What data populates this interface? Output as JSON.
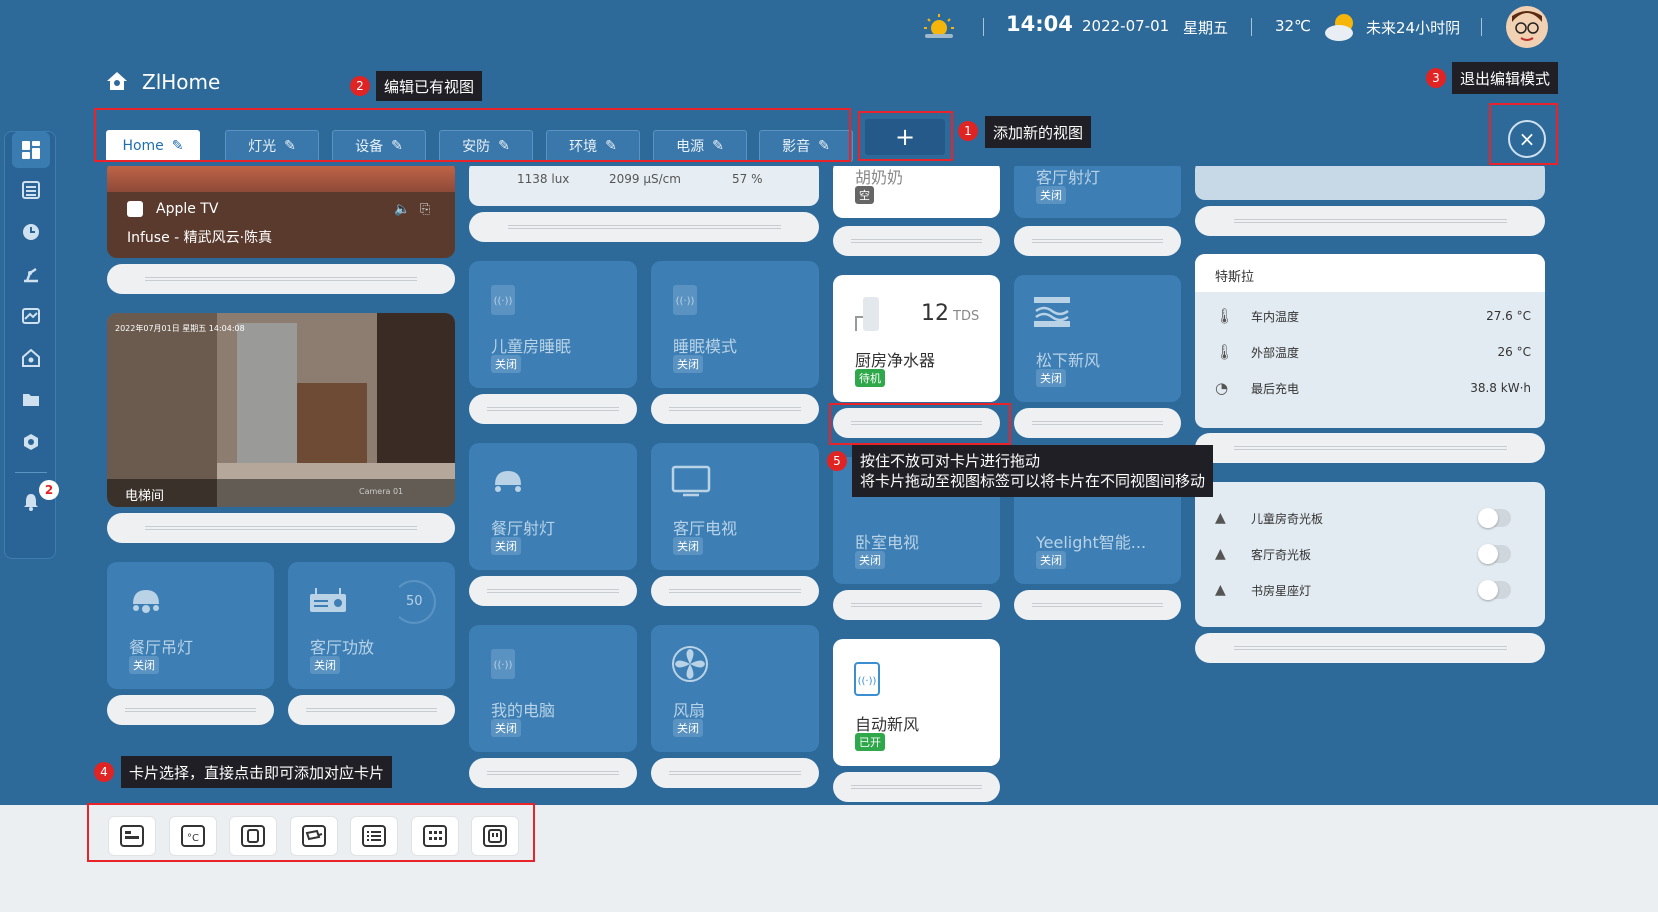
{
  "header": {
    "time": "14:04",
    "date": "2022-07-01",
    "weekday": "星期五",
    "temperature": "32℃",
    "forecast": "未来24小时阴",
    "app_title": "ZlHome"
  },
  "tabs": [
    {
      "label": "Home"
    },
    {
      "label": "灯光"
    },
    {
      "label": "设备"
    },
    {
      "label": "安防"
    },
    {
      "label": "环境"
    },
    {
      "label": "电源"
    },
    {
      "label": "影音"
    }
  ],
  "add_tab_label": "+",
  "exit_button_label": "×",
  "tips": {
    "t1": "添加新的视图",
    "t2": "编辑已有视图",
    "t3": "退出编辑模式",
    "t4": "卡片选择，直接点击即可添加对应卡片",
    "t5_line1": "按住不放可对卡片进行拖动",
    "t5_line2": "将卡片拖动至视图标签可以将卡片在不同视图间移动"
  },
  "tip_numbers": [
    "1",
    "2",
    "3",
    "4",
    "5"
  ],
  "notifications_count": "2",
  "media": {
    "source": "Apple TV",
    "title": "Infuse - 精武风云·陈真"
  },
  "camera": {
    "label": "电梯间",
    "overlay_time": "2022年07月01日 星期五 14:04:08",
    "overlay_cam": "Camera 01"
  },
  "sensors": {
    "lux": "1138 lux",
    "conductivity": "2099 μS/cm",
    "humidity": "57 %"
  },
  "cards": {
    "c1": {
      "name": "儿童房睡眠",
      "state": "关闭"
    },
    "c2": {
      "name": "睡眠模式",
      "state": "关闭"
    },
    "c3": {
      "name": "餐厅射灯",
      "state": "关闭"
    },
    "c4": {
      "name": "客厅电视",
      "state": "关闭"
    },
    "c5": {
      "name": "我的电脑",
      "state": "关闭"
    },
    "c6": {
      "name": "风扇",
      "state": "关闭"
    },
    "c7": {
      "name": "餐厅吊灯",
      "state": "关闭"
    },
    "c8": {
      "name": "客厅功放",
      "state": "关闭",
      "value": "50"
    },
    "c9": {
      "name": "胡奶奶",
      "state": "空"
    },
    "c10": {
      "name": "客厅射灯",
      "state": "关闭"
    },
    "c11": {
      "name": "厨房净水器",
      "state": "待机",
      "value": "12",
      "unit": "TDS"
    },
    "c12": {
      "name": "松下新风",
      "state": "关闭"
    },
    "c13": {
      "name": "卧室电视",
      "state": "关闭"
    },
    "c14": {
      "name": "Yeelight智能...",
      "state": "关闭"
    },
    "c15": {
      "name": "自动新风",
      "state": "已开"
    }
  },
  "tesla": {
    "title": "特斯拉",
    "rows": [
      {
        "label": "车内温度",
        "value": "27.6 °C"
      },
      {
        "label": "外部温度",
        "value": "26 °C"
      },
      {
        "label": "最后充电",
        "value": "38.8 kW·h"
      }
    ]
  },
  "switches": [
    {
      "label": "儿童房奇光板",
      "on": false
    },
    {
      "label": "客厅奇光板",
      "on": false
    },
    {
      "label": "书房星座灯",
      "on": false
    }
  ],
  "toolbar_icons": [
    "entity-card-icon",
    "thermostat-card-icon",
    "device-card-icon",
    "camera-card-icon",
    "list-card-icon",
    "grid-card-icon",
    "socket-card-icon"
  ],
  "colors": {
    "background": "#2d6a9a",
    "accent": "#1f6fb0",
    "highlight": "#e8232a",
    "on_badge": "#2ea84a"
  }
}
